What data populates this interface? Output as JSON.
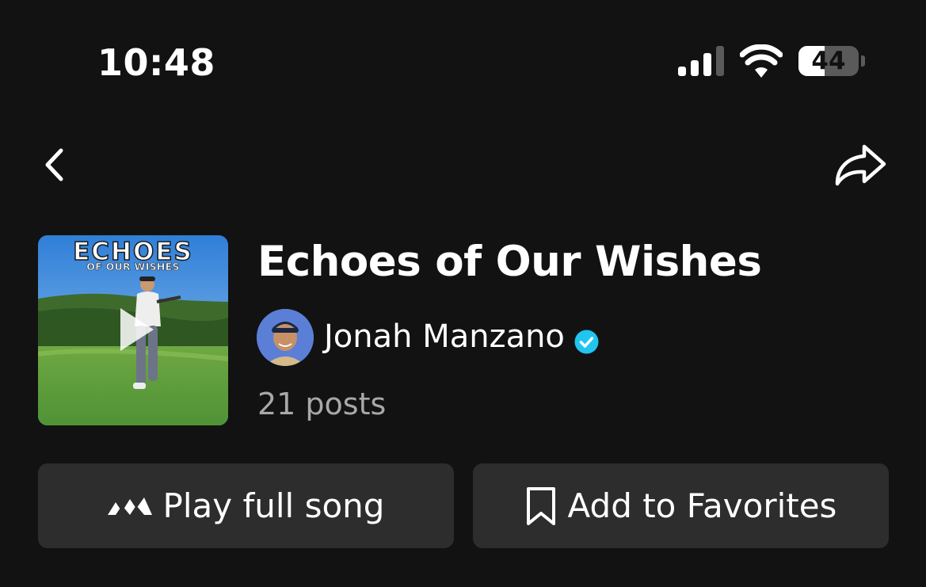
{
  "status_bar": {
    "time": "10:48",
    "battery_level": "44",
    "icons": [
      "cellular-signal-icon",
      "wifi-icon",
      "battery-icon"
    ]
  },
  "nav": {
    "back_icon": "chevron-left-icon",
    "share_icon": "share-arrow-icon"
  },
  "song": {
    "cover_title": "ECHOES",
    "cover_subtitle": "OF OUR WISHES",
    "title": "Echoes of Our Wishes",
    "artist": "Jonah Manzano",
    "verified": true,
    "posts": "21 posts"
  },
  "actions": {
    "play_label": "Play full song",
    "play_icon": "music-service-logo-icon",
    "favorite_label": "Add to Favorites",
    "favorite_icon": "bookmark-icon"
  },
  "colors": {
    "background": "#121212",
    "button_bg": "#2d2d2d",
    "secondary_text": "#a8a8a8",
    "verified": "#20c5f0"
  }
}
